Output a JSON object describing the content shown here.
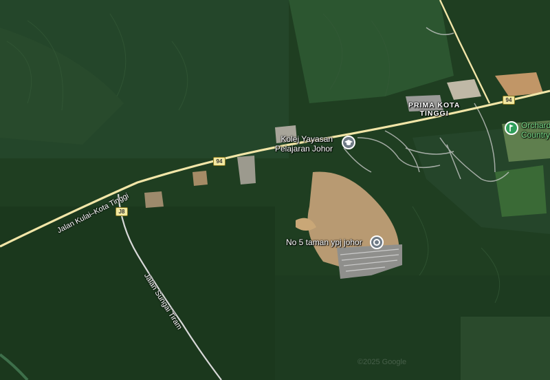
{
  "labels": {
    "kolej": "Kolej Yayasan\nPelajaran Johor",
    "prima": "PRIMA KOTA\nTINGGI",
    "no5": "No 5 taman ypj johor",
    "orchard": "Orchard\nCountry",
    "jalan_kulai": "Jalan Kulai–Kota Tinggi",
    "jalan_sungai": "Jalan Sungai Tiram"
  },
  "shields": {
    "route_94_a": "94",
    "route_94_b": "94",
    "route_j8": "J8"
  },
  "watermark": "©2025 Google",
  "colors": {
    "forest": "#1f3e21",
    "forest_light": "#2d5630",
    "road": "#f2e6a8",
    "minor_road": "#cfcfcf",
    "bare_land": "#b89a72",
    "pin_gray": "#6f7b86",
    "pin_green": "#2f9e5a"
  }
}
